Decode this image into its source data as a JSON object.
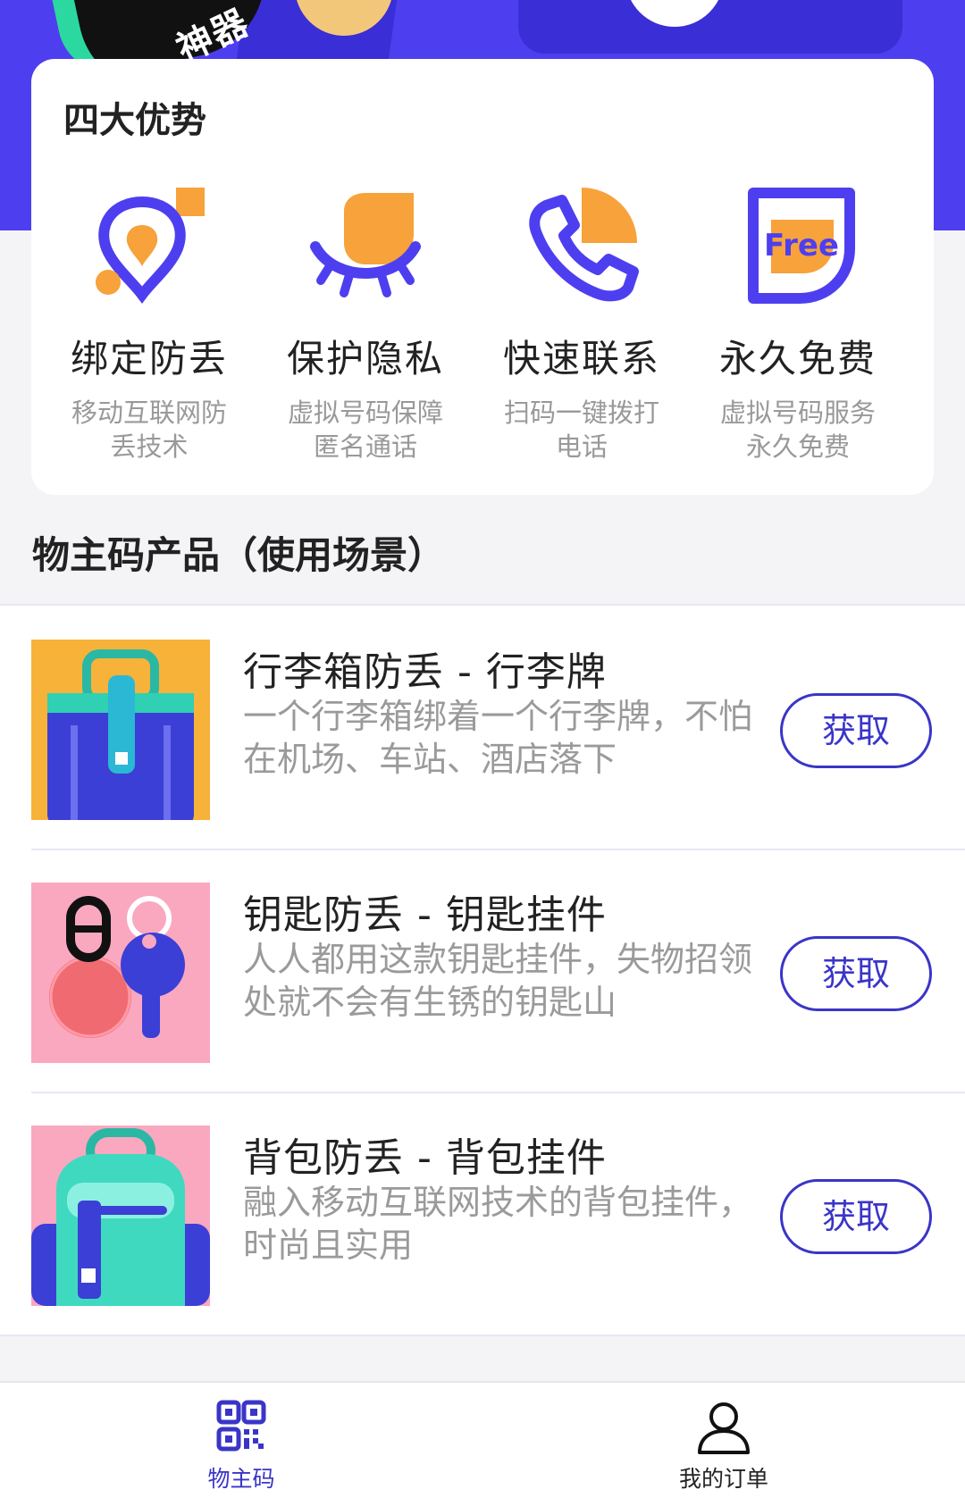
{
  "banner": {
    "badge_text": "神器"
  },
  "advantages": {
    "title": "四大优势",
    "items": [
      {
        "icon": "location-pin-icon",
        "name": "绑定防丢",
        "desc": "移动互联网防丢技术"
      },
      {
        "icon": "eye-privacy-icon",
        "name": "保护隐私",
        "desc": "虚拟号码保障匿名通话"
      },
      {
        "icon": "phone-icon",
        "name": "快速联系",
        "desc": "扫码一键拨打电话"
      },
      {
        "icon": "free-icon",
        "name": "永久免费",
        "desc": "虚拟号码服务永久免费",
        "icon_text": "Free"
      }
    ]
  },
  "section": {
    "title": "物主码产品（使用场景）"
  },
  "products": [
    {
      "name": "行李箱防丢 - 行李牌",
      "desc": "一个行李箱绑着一个行李牌，不怕在机场、车站、酒店落下",
      "button": "获取",
      "image": "luggage-tag-image"
    },
    {
      "name": "钥匙防丢 - 钥匙挂件",
      "desc": "人人都用这款钥匙挂件，失物招领处就不会有生锈的钥匙山",
      "button": "获取",
      "image": "key-pendant-image"
    },
    {
      "name": "背包防丢 - 背包挂件",
      "desc": "融入移动互联网技术的背包挂件，时尚且实用",
      "button": "获取",
      "image": "backpack-pendant-image"
    }
  ],
  "nav": {
    "items": [
      {
        "icon": "qr-code-icon",
        "label": "物主码",
        "active": true
      },
      {
        "icon": "user-icon",
        "label": "我的订单",
        "active": false
      }
    ]
  },
  "colors": {
    "primary": "#3a35c8",
    "banner": "#4d3ff0",
    "accent": "#f7a23a",
    "text_muted": "#999999"
  }
}
